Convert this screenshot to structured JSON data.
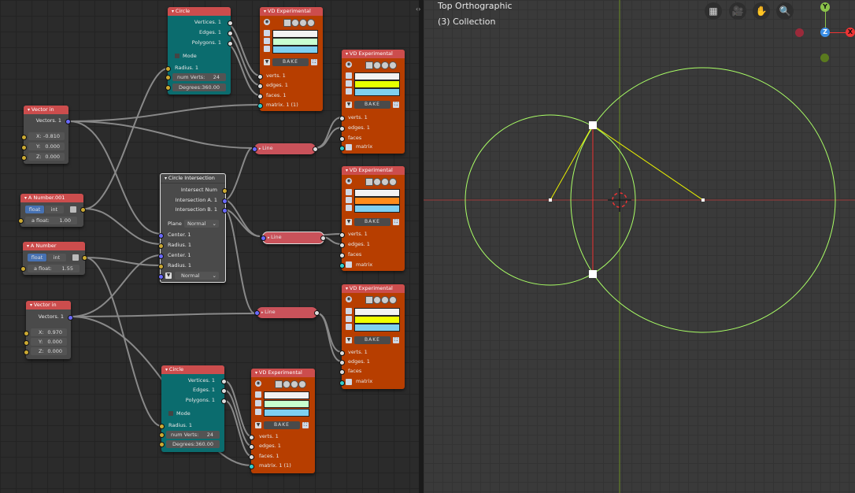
{
  "viewport": {
    "view_name": "Top Orthographic",
    "collection": "(3) Collection",
    "gizmo": {
      "y": "Y",
      "z": "Z",
      "x": "X"
    }
  },
  "nodes": {
    "circle_top": {
      "title": "Circle",
      "out1": "Vertices. 1",
      "out2": "Edges. 1",
      "out3": "Polygons. 1",
      "mode": "Mode",
      "radius": "Radius. 1",
      "num_verts_label": "num Verts:",
      "num_verts": "24",
      "degrees": "Degrees:360.00"
    },
    "circle_bottom": {
      "title": "Circle",
      "out1": "Vertices. 1",
      "out2": "Edges. 1",
      "out3": "Polygons. 1",
      "mode": "Mode",
      "radius": "Radius. 1",
      "num_verts_label": "num Verts:",
      "num_verts": "24",
      "degrees": "Degrees:360.00"
    },
    "vd1": {
      "title": "VD Experimental",
      "bake": "BAKE",
      "i1": "verts. 1",
      "i2": "edges. 1",
      "i3": "faces. 1",
      "i4": "matrix. 1 (1)"
    },
    "vd2": {
      "title": "VD Experimental",
      "bake": "BAKE",
      "i1": "verts. 1",
      "i2": "edges. 1",
      "i3": "faces",
      "i4": "matrix"
    },
    "vd3": {
      "title": "VD Experimental",
      "bake": "BAKE",
      "i1": "verts. 1",
      "i2": "edges. 1",
      "i3": "faces",
      "i4": "matrix"
    },
    "vd4": {
      "title": "VD Experimental",
      "bake": "BAKE",
      "i1": "verts. 1",
      "i2": "edges. 1",
      "i3": "faces",
      "i4": "matrix"
    },
    "vd5": {
      "title": "VD Experimental",
      "bake": "BAKE",
      "i1": "verts. 1",
      "i2": "edges. 1",
      "i3": "faces. 1",
      "i4": "matrix. 1 (1)"
    },
    "vec1": {
      "title": "Vector in",
      "out": "Vectors. 1",
      "x": "X:",
      "xv": "-0.810",
      "y": "Y:",
      "yv": "0.000",
      "z": "Z:",
      "zv": "0.000"
    },
    "vec2": {
      "title": "Vector in",
      "out": "Vectors. 1",
      "x": "X:",
      "xv": "0.970",
      "y": "Y:",
      "yv": "0.000",
      "z": "Z:",
      "zv": "0.000"
    },
    "num1": {
      "title": "A Number.001",
      "float": "float",
      "int": "int",
      "label": "a float:",
      "value": "1.00"
    },
    "num2": {
      "title": "A Number",
      "float": "float",
      "int": "int",
      "label": "a float:",
      "value": "1.55"
    },
    "ci": {
      "title": "Circle Intersection",
      "o1": "Intersect Num",
      "o2": "Intersection A. 1",
      "o3": "Intersection B. 1",
      "plane_label": "Plane",
      "plane_value": "Normal",
      "in1": "Center. 1",
      "in2": "Radius. 1",
      "in3": "Center. 1",
      "in4": "Radius. 1",
      "normal": "Normal"
    },
    "line1": {
      "title": "Line"
    },
    "line2": {
      "title": "Line"
    },
    "line3": {
      "title": "Line"
    }
  },
  "colors": {
    "vd_header": "#cc4d4d",
    "vd_body": "#b73e00",
    "circle_header": "#cc4d4d",
    "circle_body": "#0b6c6e",
    "viewer_green": "#aaff66",
    "viewer_yellow": "#e8f000",
    "viewer_red": "#e33"
  },
  "vd_swatches": {
    "vd1": [
      "#f2f2f2",
      "#c8ffd0",
      "#7fd0f0"
    ],
    "vd2": [
      "#f2f2f2",
      "#e6ff00",
      "#7fd0f0"
    ],
    "vd3": [
      "#f2f2f2",
      "#ff8c1a",
      "#7fd0f0"
    ],
    "vd4": [
      "#f2f2f2",
      "#f0ff00",
      "#7fd0f0"
    ],
    "vd5": [
      "#f2f2f2",
      "#c8ffd0",
      "#7fd0f0"
    ]
  }
}
